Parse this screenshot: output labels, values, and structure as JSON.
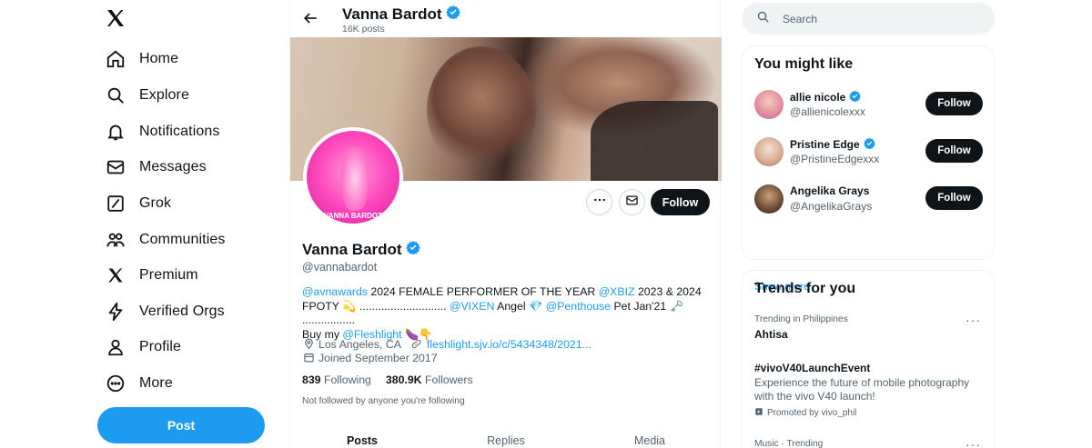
{
  "nav": {
    "items": [
      {
        "label": "Home",
        "icon": "home-icon"
      },
      {
        "label": "Explore",
        "icon": "search-icon"
      },
      {
        "label": "Notifications",
        "icon": "bell-icon"
      },
      {
        "label": "Messages",
        "icon": "envelope-icon"
      },
      {
        "label": "Grok",
        "icon": "grok-icon"
      },
      {
        "label": "Communities",
        "icon": "people-icon"
      },
      {
        "label": "Premium",
        "icon": "x-logo-icon"
      },
      {
        "label": "Verified Orgs",
        "icon": "lightning-icon"
      },
      {
        "label": "Profile",
        "icon": "person-icon"
      },
      {
        "label": "More",
        "icon": "more-circle-icon"
      }
    ],
    "post_label": "Post"
  },
  "header": {
    "name": "Vanna Bardot",
    "posts_count": "16K posts"
  },
  "profile": {
    "name": "Vanna Bardot",
    "handle": "@vannabardot",
    "follow_label": "Follow",
    "avatar_text": "VANNA BARDOT",
    "bio": {
      "l1_a": "@avnawards",
      "l1_b": " 2024 FEMALE PERFORMER OF THE YEAR ",
      "l1_c": "@XBIZ",
      "l1_d": " 2023 & 2024",
      "l2_a": "FPOTY 💫 ............................ ",
      "l2_b": "@VIXEN",
      "l2_c": " Angel 💎 ",
      "l2_d": "@Penthouse",
      "l2_e": " Pet Jan'21 🗝️ .................",
      "l3_a": "Buy my ",
      "l3_b": "@Fleshlight",
      "l3_c": " 🍆👇"
    },
    "location": "Los Angeles, CA",
    "website": "fleshlight.sjv.io/c/5434348/2021...",
    "joined": "Joined September 2017",
    "following_count": "839",
    "following_label": "Following",
    "followers_count": "380.9K",
    "followers_label": "Followers",
    "not_followed": "Not followed by anyone you're following"
  },
  "tabs": [
    {
      "label": "Posts"
    },
    {
      "label": "Replies"
    },
    {
      "label": "Media"
    }
  ],
  "search": {
    "placeholder": "Search"
  },
  "suggestions": {
    "title": "You might like",
    "users": [
      {
        "name": "allie nicole",
        "handle": "@allienicolexxx",
        "follow": "Follow"
      },
      {
        "name": "Pristine Edge",
        "handle": "@PristineEdgexxx",
        "follow": "Follow"
      },
      {
        "name": "Angelika Grays",
        "handle": "@AngelikaGrays",
        "follow": "Follow"
      }
    ],
    "show_more": "Show more"
  },
  "trends": {
    "title": "Trends for you",
    "items": [
      {
        "context": "Trending in Philippines",
        "name": "Ahtisa"
      },
      {
        "name": "#vivoV40LaunchEvent",
        "desc": "Experience the future of mobile photography with the vivo V40 launch!",
        "promo": "Promoted by vivo_phil"
      },
      {
        "context": "Music · Trending"
      }
    ]
  },
  "colors": {
    "accent": "#1d9bf0",
    "text": "#0f1419",
    "muted": "#536471"
  }
}
